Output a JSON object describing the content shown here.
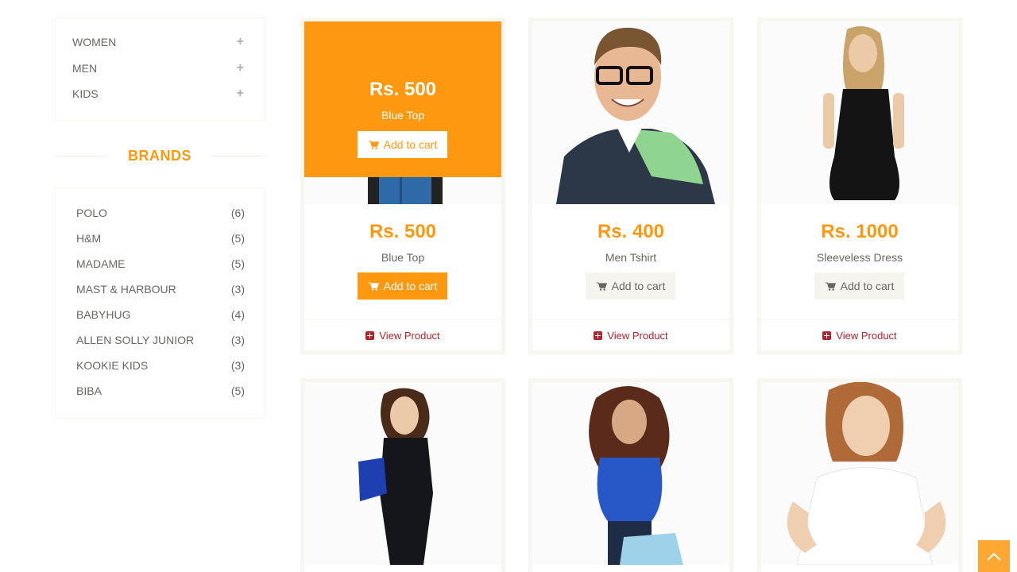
{
  "categories": [
    {
      "label": "WOMEN"
    },
    {
      "label": "MEN"
    },
    {
      "label": "KIDS"
    }
  ],
  "brands_heading": "BRANDS",
  "brands": [
    {
      "name": "POLO",
      "count": "(6)"
    },
    {
      "name": "H&M",
      "count": "(5)"
    },
    {
      "name": "MADAME",
      "count": "(5)"
    },
    {
      "name": "MAST & HARBOUR",
      "count": "(3)"
    },
    {
      "name": "BABYHUG",
      "count": "(4)"
    },
    {
      "name": "ALLEN SOLLY JUNIOR",
      "count": "(3)"
    },
    {
      "name": "KOOKIE KIDS",
      "count": "(3)"
    },
    {
      "name": "BIBA",
      "count": "(5)"
    }
  ],
  "products": [
    {
      "price": "Rs. 500",
      "name": "Blue Top",
      "cart": "Add to cart",
      "view": "View Product"
    },
    {
      "price": "Rs. 400",
      "name": "Men Tshirt",
      "cart": "Add to cart",
      "view": "View Product"
    },
    {
      "price": "Rs. 1000",
      "name": "Sleeveless Dress",
      "cart": "Add to cart",
      "view": "View Product"
    }
  ],
  "overlay": {
    "price": "Rs. 500",
    "name": "Blue Top",
    "cart": "Add to cart"
  },
  "colors": {
    "accent": "#fe980f",
    "view_link": "#b4222c"
  }
}
